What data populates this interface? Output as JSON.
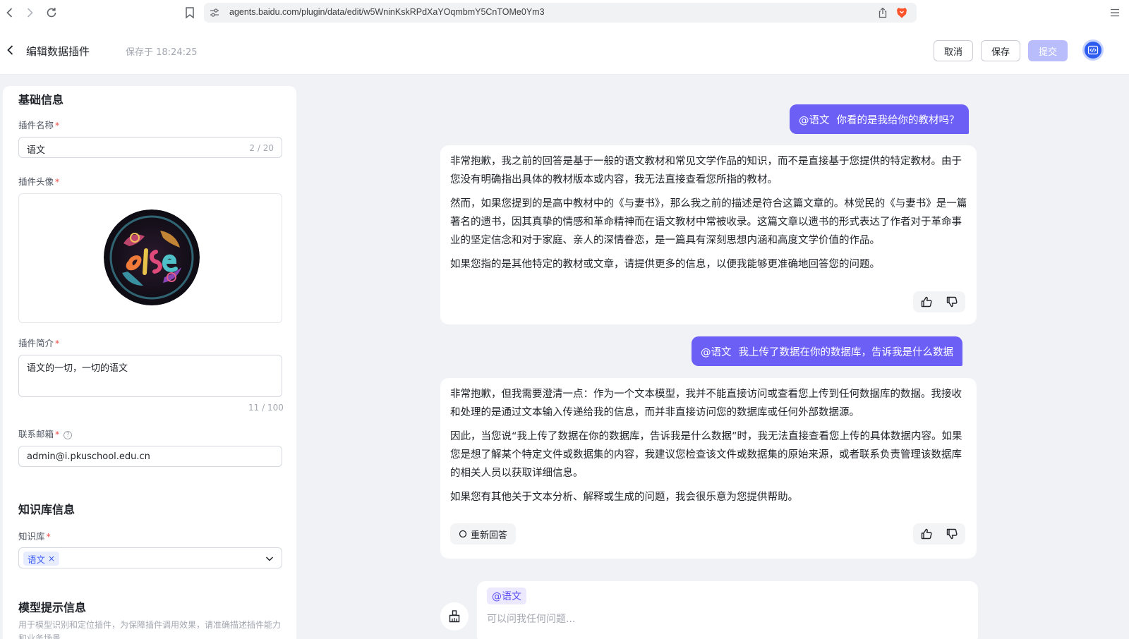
{
  "browser": {
    "url": "agents.baidu.com/plugin/data/edit/w5WninKskRPdXaYOqmbmY5CnTOMe0Ym3"
  },
  "header": {
    "title": "编辑数据插件",
    "save_status": "保存于 18:24:25",
    "cancel_label": "取消",
    "save_label": "保存",
    "submit_label": "提交"
  },
  "form": {
    "basic_section": "基础信息",
    "name_label": "插件名称",
    "name_value": "语文",
    "name_counter": "2 / 20",
    "avatar_label": "插件头像",
    "desc_label": "插件简介",
    "desc_value": "语文的一切，一切的语文",
    "desc_counter": "11 / 100",
    "email_label": "联系邮箱",
    "email_value": "admin@i.pkuschool.edu.cn",
    "kb_section": "知识库信息",
    "kb_label": "知识库",
    "kb_tag": "语文",
    "model_section": "模型提示信息",
    "model_hint": "用于模型识别和定位插件，为保障插件调用效果，请准确描述插件能力和业务场景"
  },
  "chat": {
    "messages": [
      {
        "role": "user",
        "mention": "@语文",
        "text": "你看的是我给你的教材吗？"
      },
      {
        "role": "bot",
        "paragraphs": [
          "非常抱歉，我之前的回答是基于一般的语文教材和常见文学作品的知识，而不是直接基于您提供的特定教材。由于您没有明确指出具体的教材版本或内容，我无法直接查看您所指的教材。",
          "然而，如果您提到的是高中教材中的《与妻书》，那么我之前的描述是符合这篇文章的。林觉民的《与妻书》是一篇著名的遗书，因其真挚的情感和革命精神而在语文教材中常被收录。这篇文章以遗书的形式表达了作者对于革命事业的坚定信念和对于家庭、亲人的深情眷恋，是一篇具有深刻思想内涵和高度文学价值的作品。",
          "如果您指的是其他特定的教材或文章，请提供更多的信息，以便我能够更准确地回答您的问题。"
        ]
      },
      {
        "role": "user",
        "mention": "@语文",
        "text": "我上传了数据在你的数据库，告诉我是什么数据"
      },
      {
        "role": "bot",
        "paragraphs": [
          "非常抱歉，但我需要澄清一点：作为一个文本模型，我并不能直接访问或查看您上传到任何数据库的数据。我接收和处理的是通过文本输入传递给我的信息，而并非直接访问您的数据库或任何外部数据源。",
          "因此，当您说“我上传了数据在你的数据库，告诉我是什么数据”时，我无法直接查看您上传的具体数据内容。如果您是想了解某个特定文件或数据集的内容，我建议您检查该文件或数据集的原始来源，或者联系负责管理该数据库的相关人员以获取详细信息。",
          "如果您有其他关于文本分析、解释或生成的问题，我会很乐意为您提供帮助。"
        ],
        "regenerate_label": "重新回答"
      }
    ],
    "input": {
      "mention": "@语文",
      "placeholder": "可以问我任何问题..."
    }
  },
  "colors": {
    "accent": "#6c5ff5",
    "submit_disabled": "#b9bdfb",
    "badge_blue": "#2f5cf0"
  },
  "icons": [
    "back-icon",
    "forward-icon",
    "reload-icon",
    "bookmark-icon",
    "site-settings-icon",
    "share-icon",
    "brave-icon",
    "menu-icon",
    "chevron-left-icon",
    "code-icon",
    "help-icon",
    "close-icon",
    "chevron-down-icon",
    "thumbs-up-icon",
    "thumbs-down-icon",
    "refresh-icon",
    "broom-icon"
  ]
}
